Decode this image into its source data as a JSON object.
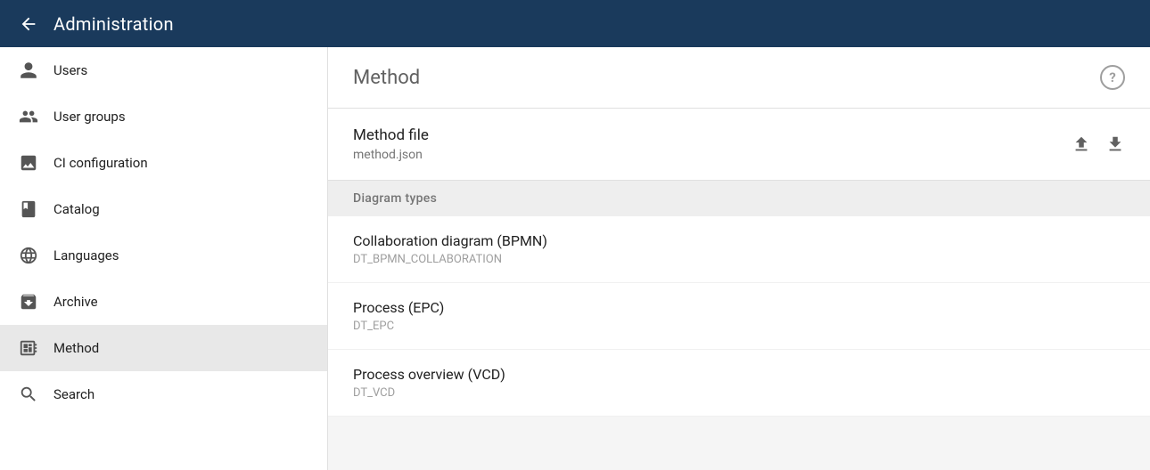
{
  "header": {
    "back_label": "←",
    "title": "Administration"
  },
  "sidebar": {
    "items": [
      {
        "id": "users",
        "label": "Users",
        "icon": "person"
      },
      {
        "id": "user-groups",
        "label": "User groups",
        "icon": "group"
      },
      {
        "id": "ci-configuration",
        "label": "CI configuration",
        "icon": "image"
      },
      {
        "id": "catalog",
        "label": "Catalog",
        "icon": "book"
      },
      {
        "id": "languages",
        "label": "Languages",
        "icon": "globe"
      },
      {
        "id": "archive",
        "label": "Archive",
        "icon": "archive"
      },
      {
        "id": "method",
        "label": "Method",
        "icon": "sitemap",
        "active": true
      },
      {
        "id": "search",
        "label": "Search",
        "icon": "search"
      }
    ]
  },
  "content": {
    "title": "Method",
    "help_label": "?",
    "method_file": {
      "label": "Method file",
      "filename": "method.json",
      "upload_title": "Upload",
      "download_title": "Download"
    },
    "diagram_types": {
      "section_label": "Diagram types",
      "items": [
        {
          "title": "Collaboration diagram (BPMN)",
          "code": "DT_BPMN_COLLABORATION"
        },
        {
          "title": "Process (EPC)",
          "code": "DT_EPC"
        },
        {
          "title": "Process overview (VCD)",
          "code": "DT_VCD"
        }
      ]
    }
  }
}
